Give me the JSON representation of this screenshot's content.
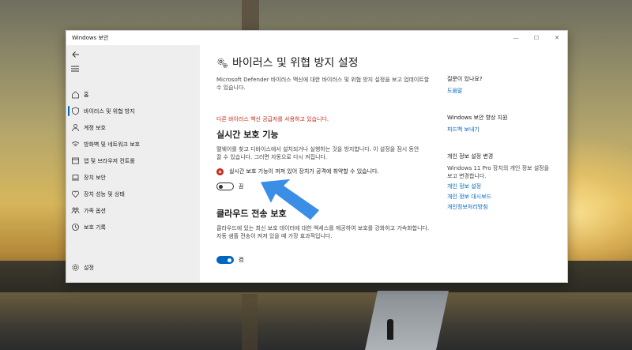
{
  "window": {
    "title": "Windows 보안"
  },
  "window_controls": {
    "minimize": "—",
    "maximize": "☐",
    "close": "✕"
  },
  "sidebar": {
    "items": [
      {
        "label": "홈",
        "icon": "home-icon"
      },
      {
        "label": "바이러스 및 위협 방지",
        "icon": "shield-icon",
        "active": true
      },
      {
        "label": "계정 보호",
        "icon": "person-icon"
      },
      {
        "label": "방화벽 및 네트워크 보호",
        "icon": "wifi-icon"
      },
      {
        "label": "앱 및 브라우저 컨트롤",
        "icon": "app-window-icon"
      },
      {
        "label": "장치 보안",
        "icon": "laptop-icon"
      },
      {
        "label": "장치 성능 및 상태",
        "icon": "heart-icon"
      },
      {
        "label": "가족 옵션",
        "icon": "family-icon"
      },
      {
        "label": "보호 기록",
        "icon": "history-icon"
      }
    ],
    "settings_label": "설정"
  },
  "main": {
    "title": "바이러스 및 위협 방지 설정",
    "description": "Microsoft Defender 바이러스 백신에 대한 바이러스 및 위협 방지 설정을 보고 업데이트할 수 있습니다.",
    "warning": "다른 바이러스 백신 공급자를 사용하고 있습니다.",
    "realtime": {
      "title": "실시간 보호 기능",
      "description": "맬웨어를 찾고 디바이스에서 설치되거나 실행하는 것을 방지합니다. 이 설정을 잠시 동안 끌 수 있습니다. 그러면 자동으로 다시 켜집니다.",
      "alert": "실시간 보호 기능이 꺼져 있어 장치가 공격에 취약할 수 있습니다.",
      "toggle_label": "끔",
      "toggle_on": false
    },
    "cloud": {
      "title": "클라우드 전송 보호",
      "description": "클라우드에 있는 최신 보호 데이터에 대한 액세스를 제공하여 보호를 강화하고 가속화합니다. 자동 샘플 전송이 켜져 있을 때 가장 효과적입니다.",
      "toggle_label": "켬",
      "toggle_on": true
    }
  },
  "right": {
    "question": {
      "heading": "질문이 있나요?",
      "link": "도움말"
    },
    "improve": {
      "heading": "Windows 보안 향상 지원",
      "link": "피드백 보내기"
    },
    "privacy": {
      "heading": "개인 정보 설정 변경",
      "text": "Windows 11 Pro 장치의 개인 정보 설정을 보고 변경합니다.",
      "links": [
        "개인 정보 설정",
        "개인 정보 대시보드",
        "개인정보처리방침"
      ]
    }
  },
  "colors": {
    "accent": "#0067c0",
    "warning": "#c42b1c",
    "arrow": "#3a8ee6"
  }
}
